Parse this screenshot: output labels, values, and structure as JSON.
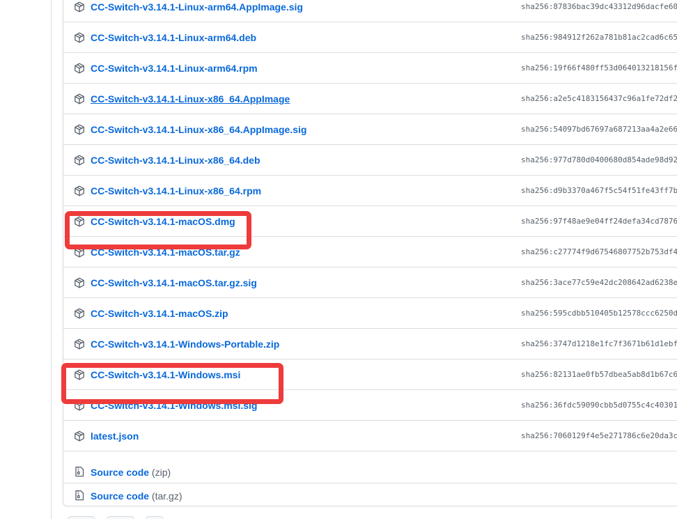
{
  "assets": [
    {
      "name": "CC-Switch-v3.14.1-Linux-arm64.AppImage.sig",
      "sha": "sha256:87836bac39dc43312d96dacfe60"
    },
    {
      "name": "CC-Switch-v3.14.1-Linux-arm64.deb",
      "sha": "sha256:984912f262a781b81ac2cad6c65"
    },
    {
      "name": "CC-Switch-v3.14.1-Linux-arm64.rpm",
      "sha": "sha256:19f66f480ff53d064013218156f"
    },
    {
      "name": "CC-Switch-v3.14.1-Linux-x86_64.AppImage",
      "sha": "sha256:a2e5c4183156437c96a1fe72df2"
    },
    {
      "name": "CC-Switch-v3.14.1-Linux-x86_64.AppImage.sig",
      "sha": "sha256:54097bd67697a687213aa4a2e66"
    },
    {
      "name": "CC-Switch-v3.14.1-Linux-x86_64.deb",
      "sha": "sha256:977d780d0400680d854ade98d92"
    },
    {
      "name": "CC-Switch-v3.14.1-Linux-x86_64.rpm",
      "sha": "sha256:d9b3370a467f5c54f51fe43ff7b"
    },
    {
      "name": "CC-Switch-v3.14.1-macOS.dmg",
      "sha": "sha256:97f48ae9e04ff24defa34cd7876"
    },
    {
      "name": "CC-Switch-v3.14.1-macOS.tar.gz",
      "sha": "sha256:c27774f9d67546807752b753df4"
    },
    {
      "name": "CC-Switch-v3.14.1-macOS.tar.gz.sig",
      "sha": "sha256:3ace77c59e42dc208642ad6238e"
    },
    {
      "name": "CC-Switch-v3.14.1-macOS.zip",
      "sha": "sha256:595cdbb510405b12578ccc6250d"
    },
    {
      "name": "CC-Switch-v3.14.1-Windows-Portable.zip",
      "sha": "sha256:3747d1218e1fc7f3671b61d1ebf"
    },
    {
      "name": "CC-Switch-v3.14.1-Windows.msi",
      "sha": "sha256:82131ae0fb57dbea5ab8d1b67c6"
    },
    {
      "name": "CC-Switch-v3.14.1-Windows.msi.sig",
      "sha": "sha256:36fdc59090cbb5d0755c4c40301"
    },
    {
      "name": "latest.json",
      "sha": "sha256:7060129f4e5e271786c6e20da3c"
    }
  ],
  "source_code": [
    {
      "label": "Source code",
      "ext": "(zip)"
    },
    {
      "label": "Source code",
      "ext": "(tar.gz)"
    }
  ],
  "icons": {
    "asset": "package-icon",
    "source": "file-zip-icon"
  },
  "colors": {
    "link": "#0969da",
    "highlight": "#ee3b3b"
  }
}
